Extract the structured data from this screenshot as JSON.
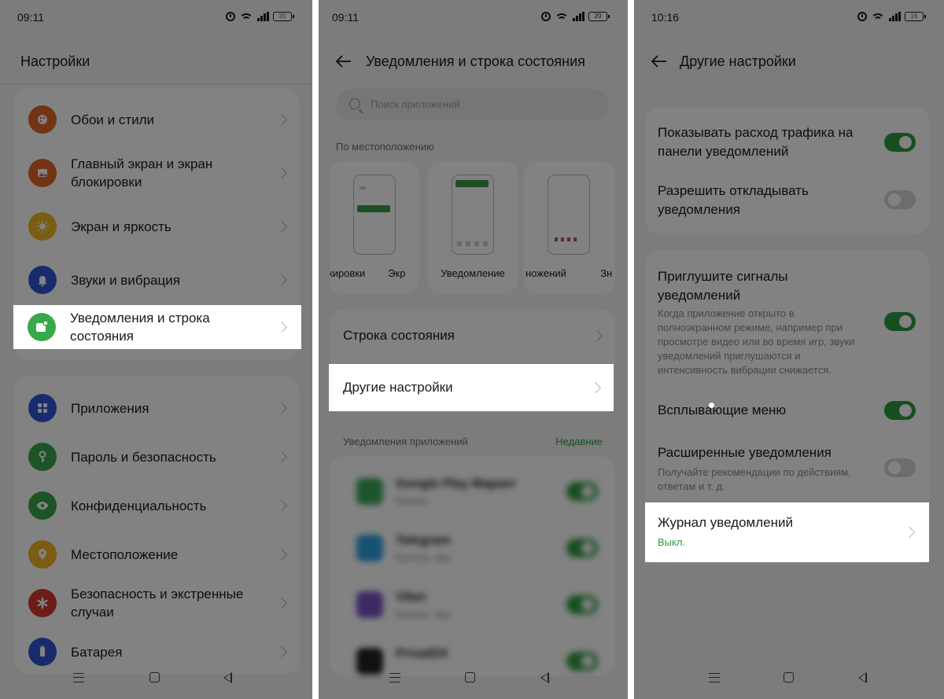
{
  "panel1": {
    "status": {
      "time": "09:11",
      "battery": "20"
    },
    "title": "Настройки",
    "group1": [
      {
        "label": "Обои и стили",
        "icon": "palette-icon",
        "color": "#e0662a"
      },
      {
        "label": "Главный экран и экран блокировки",
        "icon": "image-icon",
        "color": "#e0662a"
      },
      {
        "label": "Экран и яркость",
        "icon": "sun-icon",
        "color": "#f2b522"
      },
      {
        "label": "Звуки и вибрация",
        "icon": "bell-icon",
        "color": "#2f56d6"
      }
    ],
    "highlight": {
      "label": "Уведомления и строка состояния",
      "icon": "notification-icon",
      "color": "#38a84a"
    },
    "group2": [
      {
        "label": "Приложения",
        "icon": "apps-grid-icon",
        "color": "#2f56d6"
      },
      {
        "label": "Пароль и безопасность",
        "icon": "key-icon",
        "color": "#38a84a"
      },
      {
        "label": "Конфиденциальность",
        "icon": "eye-lock-icon",
        "color": "#38a84a"
      },
      {
        "label": "Местоположение",
        "icon": "location-icon",
        "color": "#f2b522"
      },
      {
        "label": "Безопасность и экстренные случаи",
        "icon": "asterisk-icon",
        "color": "#d63a2f"
      },
      {
        "label": "Батарея",
        "icon": "battery-icon",
        "color": "#2f56d6"
      }
    ]
  },
  "panel2": {
    "status": {
      "time": "09:11",
      "battery": "20"
    },
    "title": "Уведомления и строка состояния",
    "search_placeholder": "Поиск приложений",
    "location_label": "По местоположению",
    "styles": [
      "кировки",
      "Экр",
      "Уведомление",
      "ножений",
      "Зн"
    ],
    "status_bar_row": "Строка состояния",
    "highlight": "Другие настройки",
    "apps_label": "Уведомления приложений",
    "recent_label": "Недавние",
    "apps": [
      {
        "name": "Google Play Маркет",
        "sub": "Баннер",
        "color": "#3aa757",
        "on": true
      },
      {
        "name": "Telegram",
        "sub": "Баннер, звук",
        "color": "#2aa3e0",
        "on": true
      },
      {
        "name": "Viber",
        "sub": "Баннер, звук",
        "color": "#7b52c6",
        "on": true
      },
      {
        "name": "PrivatDX",
        "sub": "",
        "color": "#222222",
        "on": true
      }
    ],
    "accent": "#2e9c3f"
  },
  "panel3": {
    "status": {
      "time": "10:16",
      "battery": "16"
    },
    "title": "Другие настройки",
    "toggles1": [
      {
        "title": "Показывать расход трафика на панели уведомлений",
        "on": true
      },
      {
        "title": "Разрешить откладывать уведомления",
        "on": false
      }
    ],
    "mute": {
      "title": "Приглушите сигналы уведомлений",
      "desc": "Когда приложение открыто в полноэкранном режиме, например при просмотре видео или во время игр, звуки уведомлений приглушаются и интенсивность вибрации снижается.",
      "on": true
    },
    "popup": {
      "title": "Всплывающие меню",
      "on": true
    },
    "extended": {
      "title": "Расширенные уведомления",
      "desc": "Получайте рекомендации по действиям, ответам и т. д.",
      "on": false
    },
    "highlight": {
      "title": "Журнал уведомлений",
      "value": "Выкл."
    }
  }
}
